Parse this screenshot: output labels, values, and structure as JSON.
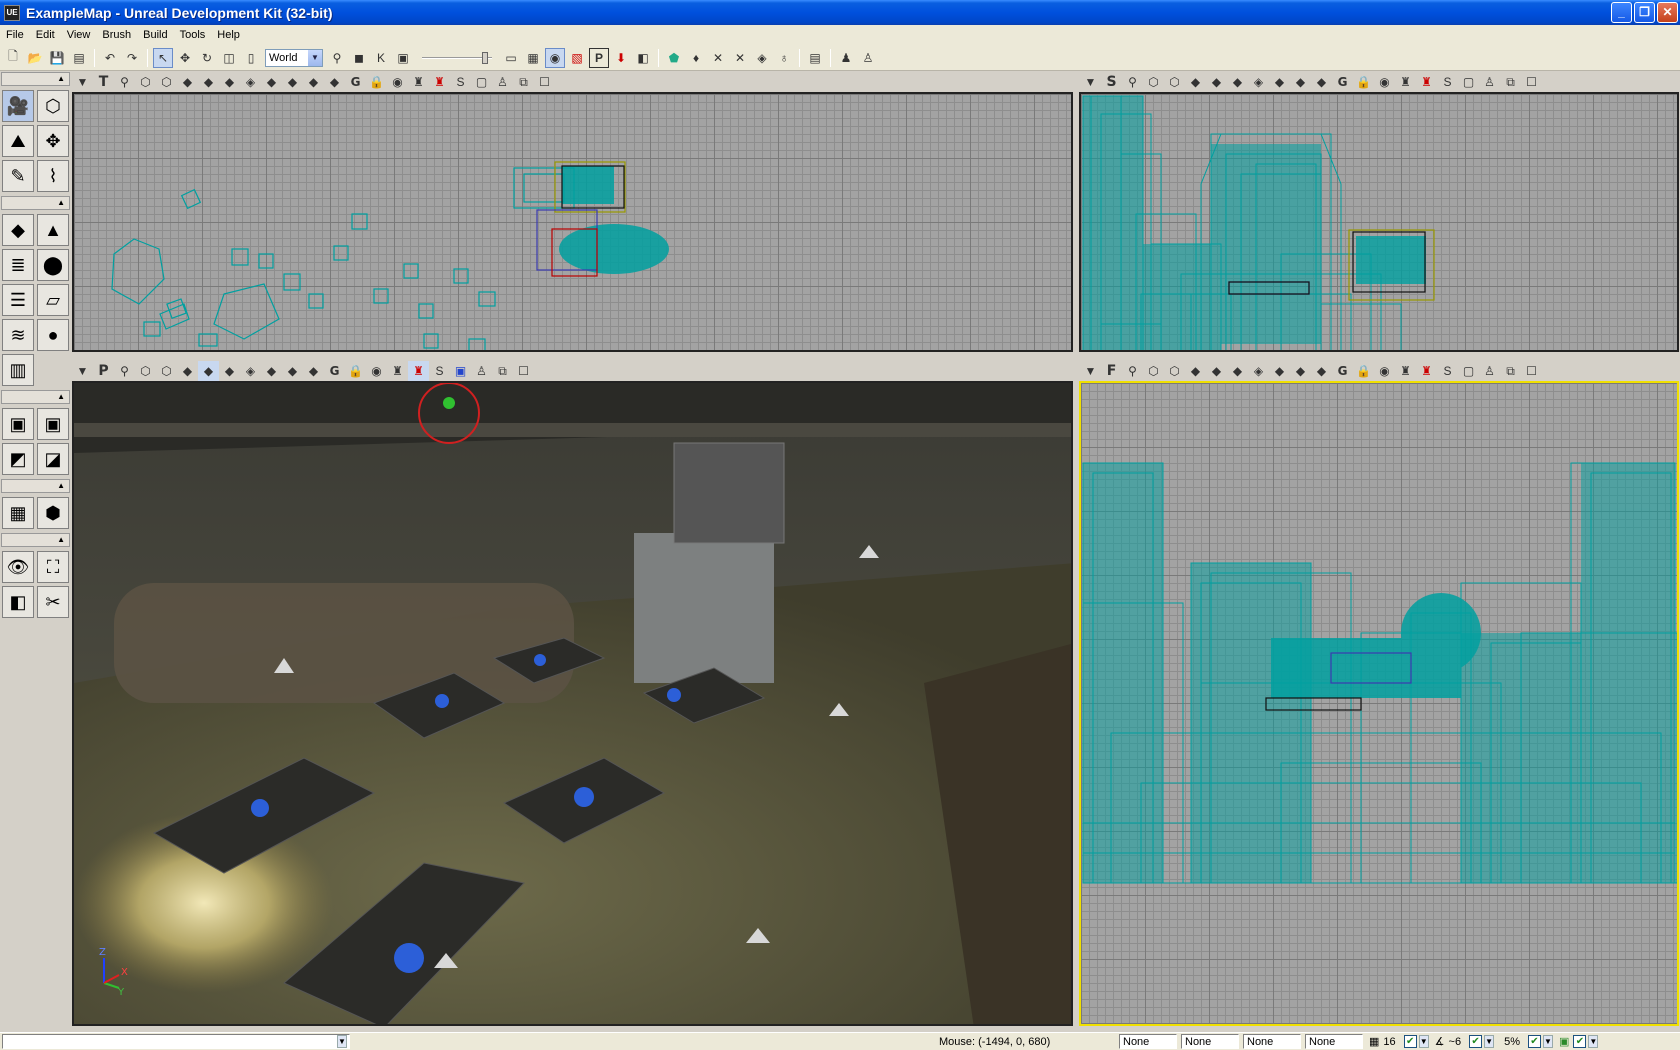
{
  "window": {
    "title": "ExampleMap - Unreal Development Kit (32-bit)",
    "app_icon": "UE",
    "buttons": {
      "minimize": "_",
      "maximize": "❐",
      "close": "✕"
    }
  },
  "menu": [
    "File",
    "Edit",
    "View",
    "Brush",
    "Build",
    "Tools",
    "Help"
  ],
  "toolbar": {
    "coordinate_system": "World",
    "build_toggle_label": "P"
  },
  "viewports": {
    "top_left": {
      "type_label": "T",
      "mode": "Top"
    },
    "top_right": {
      "type_label": "S",
      "mode": "Side"
    },
    "bottom_left": {
      "type_label": "P",
      "mode": "Perspective",
      "axis_labels": {
        "x": "X",
        "y": "Y",
        "z": "Z"
      }
    },
    "bottom_right": {
      "type_label": "F",
      "mode": "Front"
    }
  },
  "viewport_toolbar_icons": [
    "menu-arrow-icon",
    "type-label",
    "camera-icon",
    "wireframe-icon",
    "brush-wire-icon",
    "unlit-icon",
    "lit-icon",
    "detail-lighting-icon",
    "lighting-only-icon",
    "light-complexity-icon",
    "texture-density-icon",
    "shader-complexity-icon",
    "grid-toggle",
    "lock-icon",
    "realtime-icon",
    "actor-icon",
    "red-actor-icon",
    "streaming-icon",
    "maximize-icon"
  ],
  "status_bar": {
    "mouse": "Mouse: (-1494, 0, 680)",
    "combos": [
      "None",
      "None",
      "None",
      "None"
    ],
    "grid_size": "16",
    "rotation_snap": "~6",
    "scale_snap": "5%"
  },
  "colors": {
    "wireframe": "#00a0a0",
    "title_bar": "#0050dd",
    "active_viewport_border": "#f0e000"
  }
}
